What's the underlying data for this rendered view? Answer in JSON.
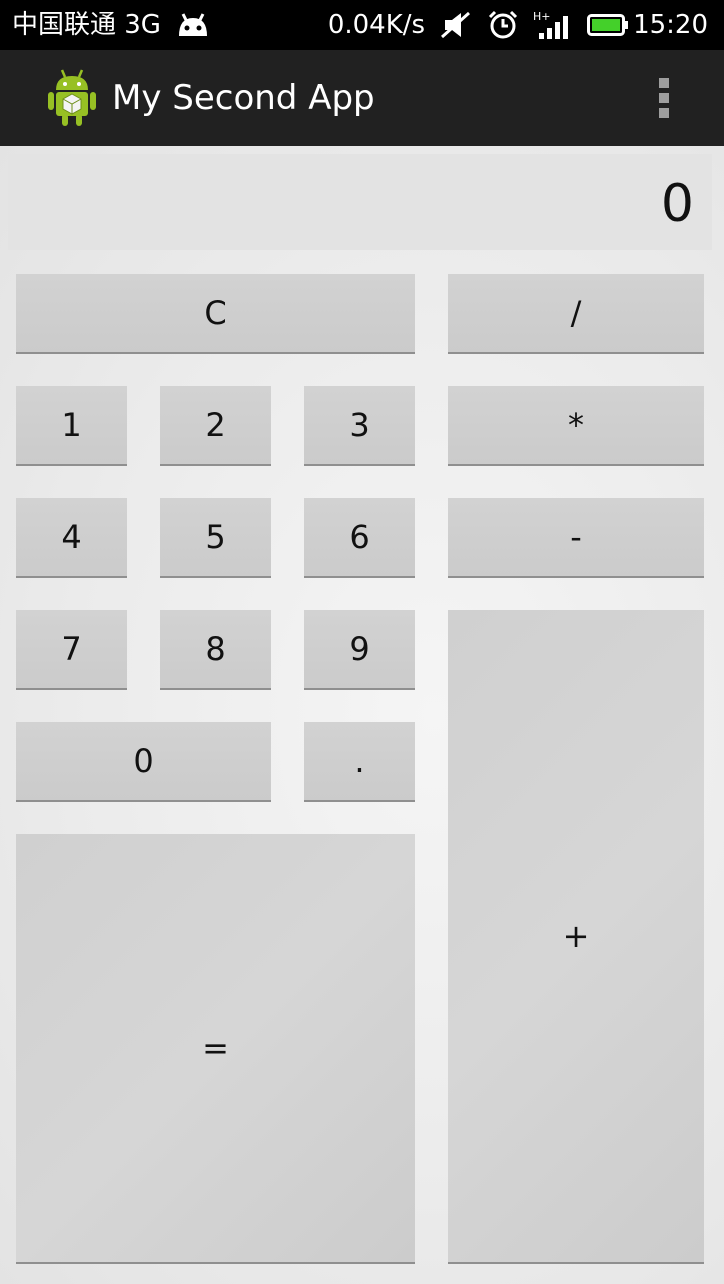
{
  "status_bar": {
    "carrier": "中国联通 3G",
    "net_speed": "0.04K/s",
    "signal_type": "H+",
    "time": "15:20",
    "icons": [
      "android-notification-icon",
      "mute-icon",
      "alarm-icon",
      "signal-icon",
      "battery-icon"
    ]
  },
  "action_bar": {
    "title": "My Second App",
    "logo_icon": "android-app-icon",
    "menu_icon": "overflow-menu-icon"
  },
  "display": {
    "value": "0"
  },
  "keys": {
    "clear": "C",
    "divide": "/",
    "multiply": "*",
    "subtract": "-",
    "add": "+",
    "equals": "=",
    "decimal": ".",
    "digit_0": "0",
    "digit_1": "1",
    "digit_2": "2",
    "digit_3": "3",
    "digit_4": "4",
    "digit_5": "5",
    "digit_6": "6",
    "digit_7": "7",
    "digit_8": "8",
    "digit_9": "9"
  },
  "colors": {
    "action_bar": "#212121",
    "key_face": "#cccccc",
    "battery": "#44d02a"
  }
}
